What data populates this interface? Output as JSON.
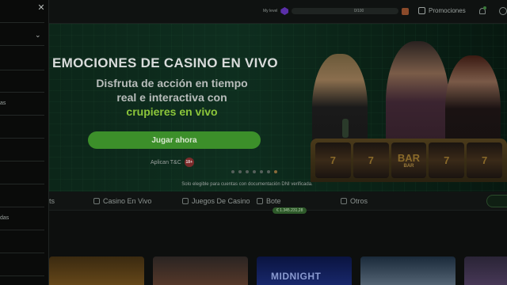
{
  "header": {
    "my_level_label": "My level",
    "level_count": "0/100",
    "level_progress": 0,
    "promotions_label": "Promociones"
  },
  "banner": {
    "title": "EMOCIONES DE CASINO EN VIVO",
    "subtitle_line1": "Disfruta de acción en tiempo",
    "subtitle_line2": "real e interactiva con",
    "subtitle_highlight": "crupieres en vivo",
    "cta_label": "Jugar ahora",
    "tnc_label": "Aplican T&C",
    "age_badge": "18+",
    "disclaimer": "Solo elegible para cuentas con documentación DNI verificada.",
    "slides_total": 7,
    "active_slide": 7,
    "reels": [
      {
        "top": "7",
        "bottom": ""
      },
      {
        "top": "7",
        "bottom": ""
      },
      {
        "top": "BAR",
        "bottom": "BAR"
      },
      {
        "top": "7",
        "bottom": ""
      },
      {
        "top": "7",
        "bottom": ""
      }
    ]
  },
  "categories": {
    "items": [
      {
        "label": "ots",
        "icon": "slots-icon"
      },
      {
        "label": "Casino En Vivo",
        "icon": "live-casino-icon"
      },
      {
        "label": "Juegos De Casino",
        "icon": "casino-games-icon"
      },
      {
        "label": "Bote",
        "icon": "jackpot-icon"
      },
      {
        "label": "Otros",
        "icon": "other-games-icon"
      }
    ],
    "jackpot_amount": "€ 1.345.231,28"
  },
  "games": {
    "items": [
      {
        "title": ""
      },
      {
        "title": ""
      },
      {
        "title": "MIDNIGHT"
      },
      {
        "title": ""
      },
      {
        "title": ""
      }
    ]
  },
  "sidepanel": {
    "close_icon": "close-icon",
    "partial_labels": [
      "as",
      "das"
    ]
  },
  "colors": {
    "accent_green": "#3c8f2a",
    "highlight_green": "#8cc63a",
    "banner_bg": "#0e2e1f"
  }
}
